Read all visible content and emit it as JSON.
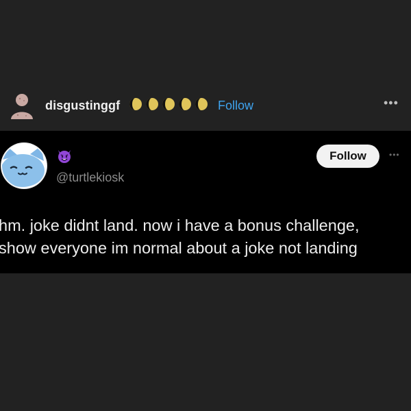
{
  "post": {
    "username": "disgustinggf",
    "username_emojis": [
      "waning-moon-icon",
      "waning-moon-icon",
      "waning-moon-icon",
      "waning-moon-icon",
      "waning-moon-icon"
    ],
    "follow_label": "Follow",
    "more_label": "•••"
  },
  "embed": {
    "name_emoji": "smiling-devil-icon",
    "handle": "@turtlekiosk",
    "follow_label": "Follow",
    "more_label": "•••",
    "text_lines": [
      "hm. joke didnt land. now i have a bonus challenge,",
      "show everyone im normal about a joke not landing"
    ]
  },
  "colors": {
    "background": "#222222",
    "embed_background": "#000000",
    "link_blue": "#3fa4f0",
    "handle_gray": "#8b8b8b"
  }
}
